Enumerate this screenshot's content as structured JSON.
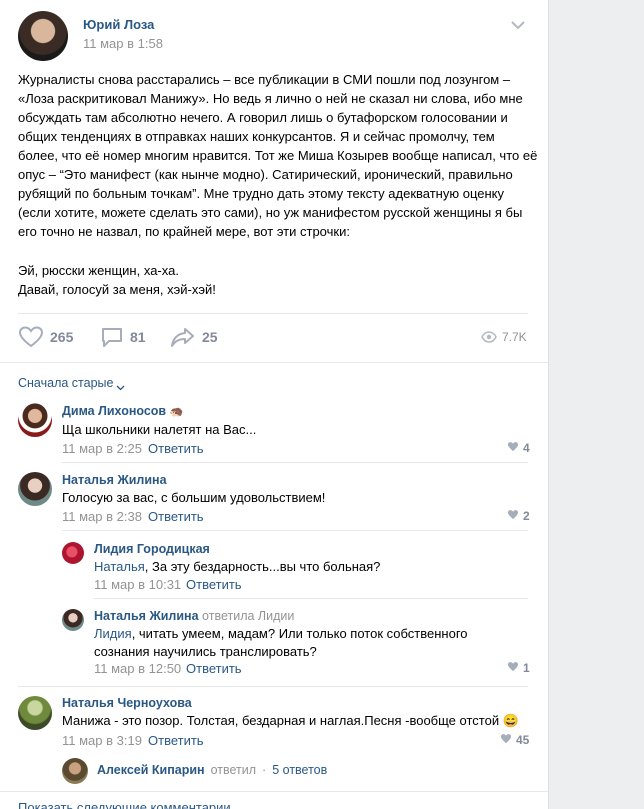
{
  "post": {
    "author": "Юрий Лоза",
    "date": "11 мар в 1:58",
    "text": "Журналисты снова расстарались – все публикации в СМИ пошли под лозунгом – «Лоза раскритиковал Манижу». Но ведь я лично о ней не сказал ни слова, ибо мне обсуждать там абсолютно нечего. А говорил лишь о бутафорском голосовании и общих тенденциях в отправках наших конкурсантов. Я и сейчас промолчу, тем более, что её номер многим нравится. Тот же Миша Козырев вообще написал, что её опус – “Это манифест (как нынче модно). Сатирический, иронический, правильно рубящий по больным точкам”. Мне трудно дать этому тексту адекватную оценку (если хотите, можете сделать это сами), но уж манифестом русской женщины я бы его точно не назвал, по крайней мере, вот эти строчки:",
    "quote_line1": "Эй, рюсски женщин, ха-ха.",
    "quote_line2": "Давай, голосуй за меня, хэй-хэй!",
    "likes": "265",
    "comments": "81",
    "shares": "25",
    "views": "7.7K"
  },
  "sort": {
    "label": "Сначала старые"
  },
  "comments": [
    {
      "author": "Дима Лихоносов",
      "emoji": "🦔",
      "text": "Ща школьники налетят на Вас...",
      "date": "11 мар в 2:25",
      "reply": "Ответить",
      "likes": "4"
    },
    {
      "author": "Наталья Жилина",
      "text": "Голосую за вас, с большим удовольствием!",
      "date": "11 мар в 2:38",
      "reply": "Ответить",
      "likes": "2"
    },
    {
      "author": "Лидия Городицкая",
      "addressee": "Наталья",
      "text": ", За эту бездарность...вы что больная?",
      "date": "11 мар в 10:31",
      "reply": "Ответить"
    },
    {
      "author": "Наталья Жилина",
      "replied": "ответила Лидии",
      "addressee": "Лидия",
      "text1": ", читать умеем, мадам? Или только поток собственного",
      "text2": "сознания научились транслировать?",
      "date": "11 мар в 12:50",
      "reply": "Ответить",
      "likes": "1"
    },
    {
      "author": "Наталья Черноухова",
      "text": "Манижа - это позор. Толстая, бездарная и наглая.Песня -вообще отстой",
      "emoji": "😄",
      "date": "11 мар в 3:19",
      "reply": "Ответить",
      "likes": "45"
    }
  ],
  "thread": {
    "author": "Алексей Кипарин",
    "replied": "ответил",
    "sep": "·",
    "count": "5 ответов"
  },
  "more": {
    "label": "Показать следующие комментарии"
  }
}
